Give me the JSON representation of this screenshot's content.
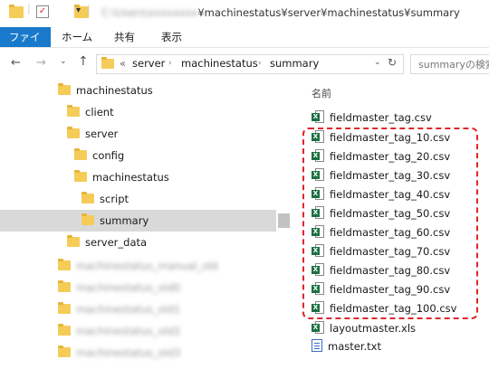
{
  "window": {
    "title_path_prefix": "C:\\Users\\xxxxxxxx",
    "title_path": "¥machinestatus¥server¥machinestatus¥summary"
  },
  "ribbon": {
    "tabs": [
      "ファイル",
      "ホーム",
      "共有",
      "表示"
    ]
  },
  "address": {
    "overflow": "«",
    "segments": [
      "server",
      "machinestatus",
      "summary"
    ],
    "search_placeholder": "summaryの検索"
  },
  "tree": {
    "items": [
      {
        "label": "machinestatus"
      },
      {
        "label": "client"
      },
      {
        "label": "server"
      },
      {
        "label": "config"
      },
      {
        "label": "machinestatus"
      },
      {
        "label": "script"
      },
      {
        "label": "summary"
      },
      {
        "label": "server_data"
      },
      {
        "label": "machinestatus_manual_old"
      },
      {
        "label": "machinestatus_old0"
      },
      {
        "label": "machinestatus_old1"
      },
      {
        "label": "machinestatus_old2"
      },
      {
        "label": "machinestatus_old3"
      }
    ]
  },
  "files": {
    "column_name": "名前",
    "items": [
      {
        "name": "fieldmaster_tag.csv",
        "icon": "excel-csv-icon"
      },
      {
        "name": "fieldmaster_tag_10.csv",
        "icon": "excel-csv-icon"
      },
      {
        "name": "fieldmaster_tag_20.csv",
        "icon": "excel-csv-icon"
      },
      {
        "name": "fieldmaster_tag_30.csv",
        "icon": "excel-csv-icon"
      },
      {
        "name": "fieldmaster_tag_40.csv",
        "icon": "excel-csv-icon"
      },
      {
        "name": "fieldmaster_tag_50.csv",
        "icon": "excel-csv-icon"
      },
      {
        "name": "fieldmaster_tag_60.csv",
        "icon": "excel-csv-icon"
      },
      {
        "name": "fieldmaster_tag_70.csv",
        "icon": "excel-csv-icon"
      },
      {
        "name": "fieldmaster_tag_80.csv",
        "icon": "excel-csv-icon"
      },
      {
        "name": "fieldmaster_tag_90.csv",
        "icon": "excel-csv-icon"
      },
      {
        "name": "fieldmaster_tag_100.csv",
        "icon": "excel-csv-icon"
      },
      {
        "name": "layoutmaster.xls",
        "icon": "excel-xls-icon"
      },
      {
        "name": "master.txt",
        "icon": "text-file-icon"
      }
    ]
  },
  "colors": {
    "file_tab": "#1979ca",
    "selection": "#d9d9d9",
    "highlight_border": "#e0262b",
    "folder": "#f5cc58",
    "excel": "#1d7044"
  }
}
